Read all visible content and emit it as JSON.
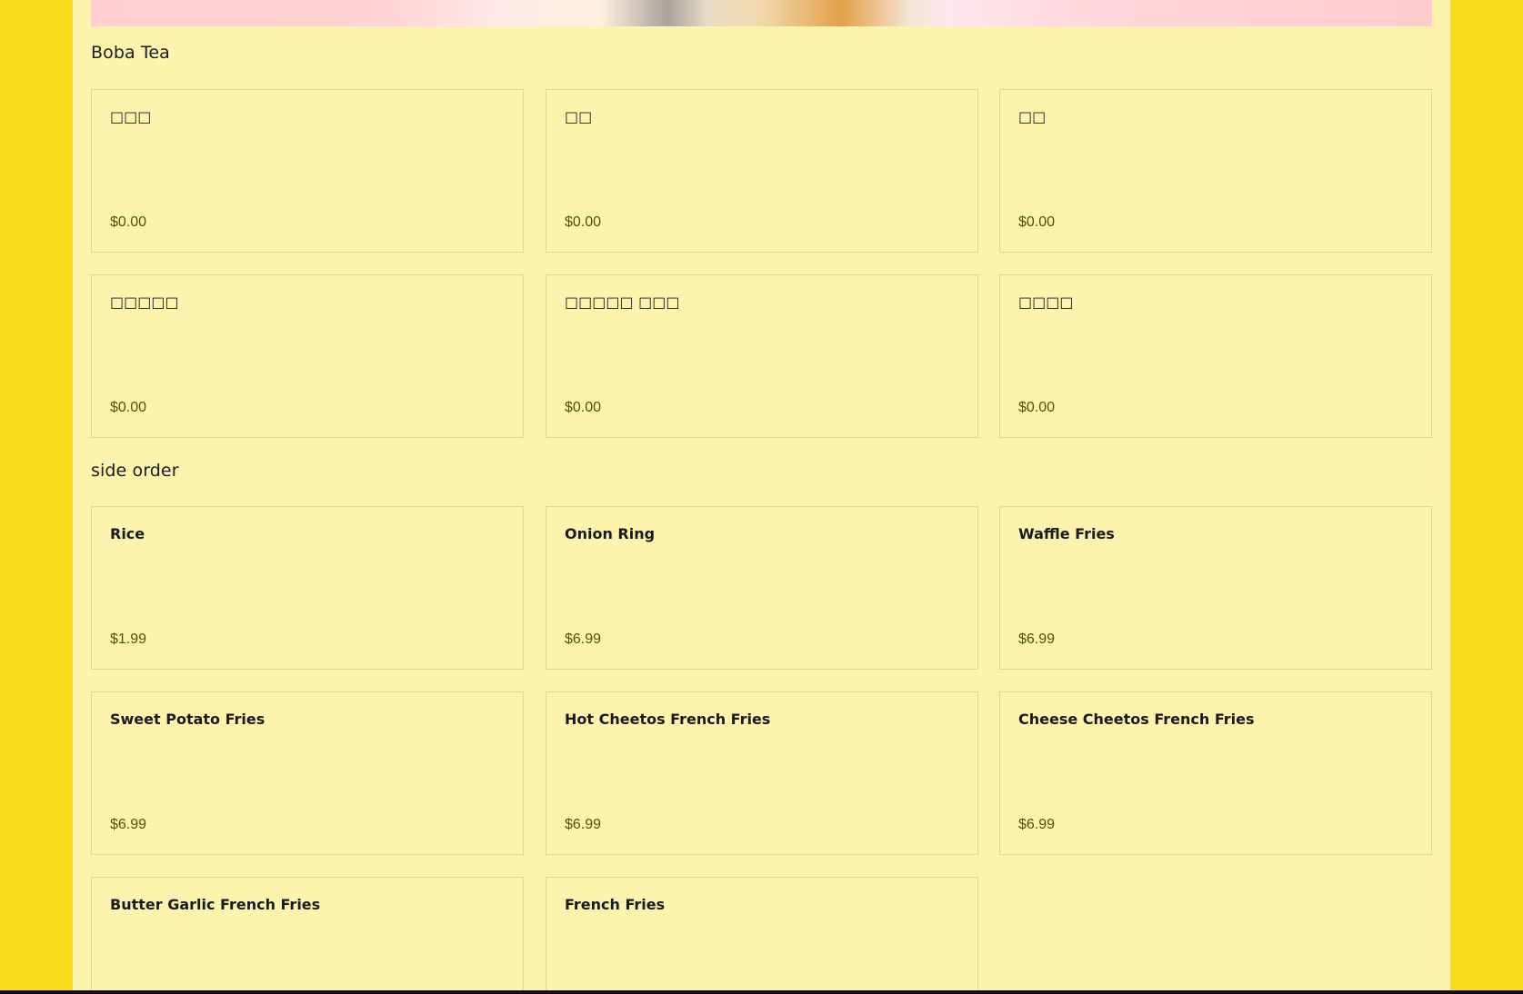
{
  "sections": [
    {
      "title": "Boba Tea",
      "items": [
        {
          "name": "□□□",
          "price": "$0.00"
        },
        {
          "name": "□□",
          "price": "$0.00"
        },
        {
          "name": "□□",
          "price": "$0.00"
        },
        {
          "name": "□□□□□",
          "price": "$0.00"
        },
        {
          "name": "□□□□□ □□□",
          "price": "$0.00"
        },
        {
          "name": "□□□□",
          "price": "$0.00"
        }
      ]
    },
    {
      "title": "side order",
      "items": [
        {
          "name": "Rice",
          "price": "$1.99"
        },
        {
          "name": "Onion Ring",
          "price": "$6.99"
        },
        {
          "name": "Waffle Fries",
          "price": "$6.99"
        },
        {
          "name": "Sweet Potato Fries",
          "price": "$6.99"
        },
        {
          "name": "Hot Cheetos French Fries",
          "price": "$6.99"
        },
        {
          "name": "Cheese Cheetos French Fries",
          "price": "$6.99"
        },
        {
          "name": "Butter Garlic French Fries",
          "price": ""
        },
        {
          "name": "French Fries",
          "price": ""
        }
      ]
    }
  ],
  "colors": {
    "outer_background": "#f8dc17",
    "panel_background": "#fdf3ad",
    "card_border": "#e2d58e",
    "price_text": "#5a4d0c"
  }
}
